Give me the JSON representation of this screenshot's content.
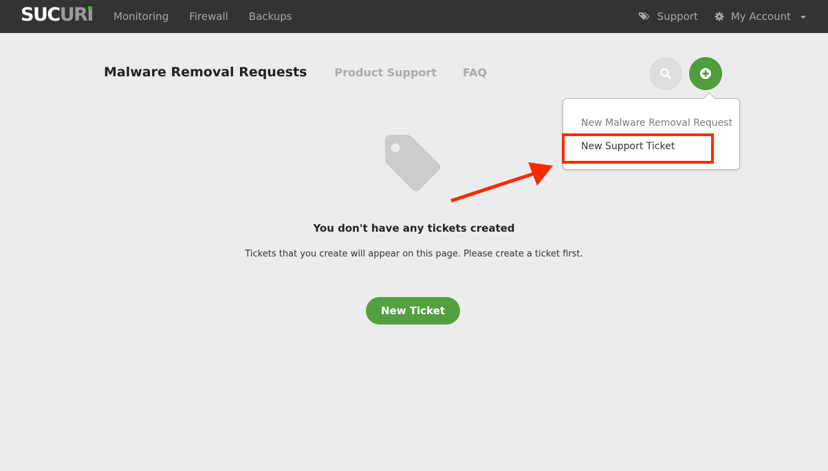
{
  "topbar": {
    "logo_white": "SUC",
    "logo_gray": "URI",
    "nav": [
      "Monitoring",
      "Firewall",
      "Backups"
    ],
    "support_label": "Support",
    "account_label": "My Account",
    "brand_green": "#4fa83d"
  },
  "tabs": {
    "active": "Malware Removal Requests",
    "items": [
      "Product Support",
      "FAQ"
    ]
  },
  "actions": {
    "search_icon": "search-icon",
    "add_icon": "plus-circle-icon"
  },
  "dropdown": {
    "items": [
      "New Malware Removal Request",
      "New Support Ticket"
    ],
    "highlighted_item": "New Support Ticket"
  },
  "empty_state": {
    "icon": "tag-icon",
    "title": "You don't have any tickets created",
    "subtitle": "Tickets that you create will appear on this page. Please create a ticket first.",
    "button_label": "New Ticket"
  },
  "annotation": {
    "color": "#ff2a00"
  }
}
